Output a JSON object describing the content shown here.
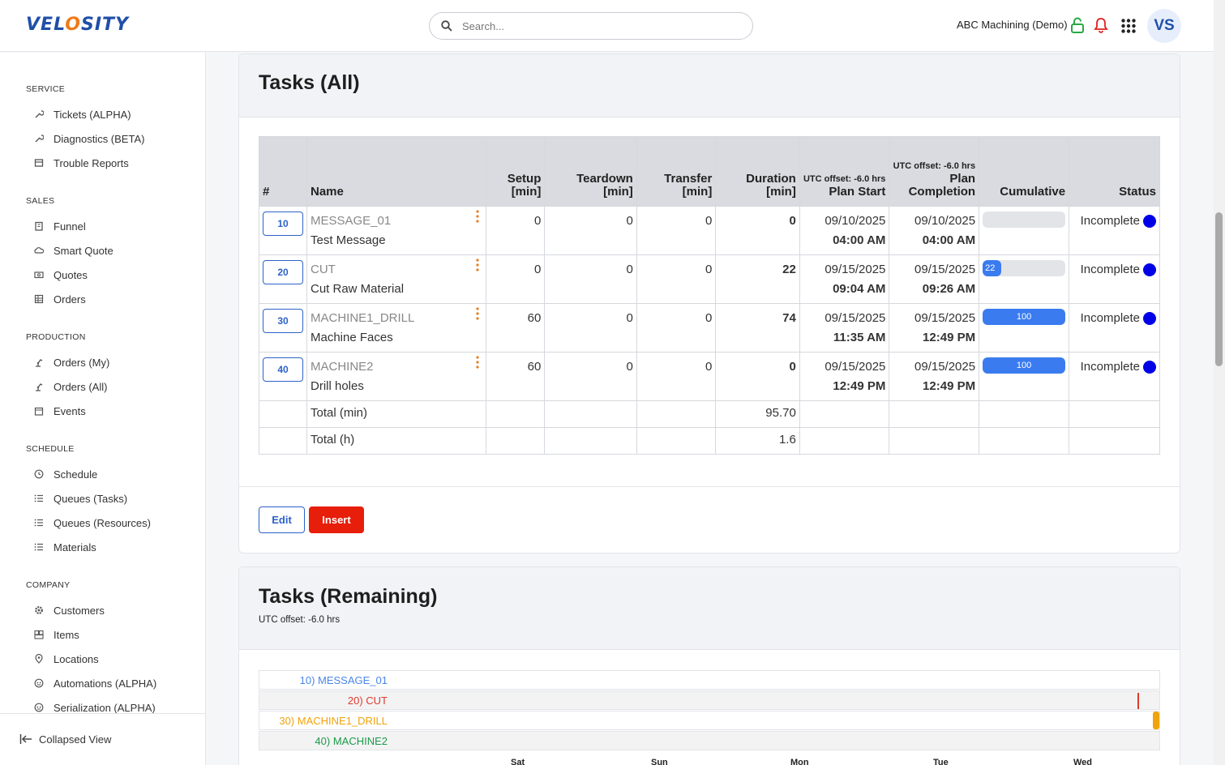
{
  "header": {
    "logo": "VELOSITY",
    "search_placeholder": "Search...",
    "company": "ABC Machining (Demo)",
    "avatar_initials": "VS"
  },
  "sidebar": {
    "sections": [
      {
        "title": "SERVICE",
        "items": [
          "Tickets (ALPHA)",
          "Diagnostics (BETA)",
          "Trouble Reports"
        ]
      },
      {
        "title": "SALES",
        "items": [
          "Funnel",
          "Smart Quote",
          "Quotes",
          "Orders"
        ]
      },
      {
        "title": "PRODUCTION",
        "items": [
          "Orders (My)",
          "Orders (All)",
          "Events"
        ]
      },
      {
        "title": "SCHEDULE",
        "items": [
          "Schedule",
          "Queues (Tasks)",
          "Queues (Resources)",
          "Materials"
        ]
      },
      {
        "title": "COMPANY",
        "items": [
          "Customers",
          "Items",
          "Locations",
          "Automations (ALPHA)",
          "Serialization (ALPHA)"
        ]
      }
    ],
    "collapsed_label": "Collapsed View"
  },
  "tasks_all": {
    "title": "Tasks (All)",
    "headers": {
      "num": "#",
      "name": "Name",
      "setup": [
        "Setup",
        "[min]"
      ],
      "teardown": [
        "Teardown",
        "[min]"
      ],
      "transfer": [
        "Transfer",
        "[min]"
      ],
      "duration": [
        "Duration",
        "[min]"
      ],
      "plan_start_note": "UTC offset: -6.0 hrs",
      "plan_start": "Plan Start",
      "plan_completion_note": "UTC offset: -6.0 hrs",
      "plan_completion": [
        "Plan",
        "Completion"
      ],
      "cumulative": "Cumulative",
      "status": "Status"
    },
    "rows": [
      {
        "op": "10",
        "code": "MESSAGE_01",
        "desc": "Test Message",
        "setup": "0",
        "teardown": "0",
        "transfer": "0",
        "duration": "0",
        "start_date": "09/10/2025",
        "start_time": "04:00 AM",
        "end_date": "09/10/2025",
        "end_time": "04:00 AM",
        "cumulative": 0,
        "cumulative_label": "",
        "status": "Incomplete"
      },
      {
        "op": "20",
        "code": "CUT",
        "desc": "Cut Raw Material",
        "setup": "0",
        "teardown": "0",
        "transfer": "0",
        "duration": "22",
        "start_date": "09/15/2025",
        "start_time": "09:04 AM",
        "end_date": "09/15/2025",
        "end_time": "09:26 AM",
        "cumulative": 22,
        "cumulative_label": "22",
        "status": "Incomplete"
      },
      {
        "op": "30",
        "code": "MACHINE1_DRILL",
        "desc": "Machine Faces",
        "setup": "60",
        "teardown": "0",
        "transfer": "0",
        "duration": "74",
        "start_date": "09/15/2025",
        "start_time": "11:35 AM",
        "end_date": "09/15/2025",
        "end_time": "12:49 PM",
        "cumulative": 100,
        "cumulative_label": "100",
        "status": "Incomplete"
      },
      {
        "op": "40",
        "code": "MACHINE2",
        "desc": "Drill holes",
        "setup": "60",
        "teardown": "0",
        "transfer": "0",
        "duration": "0",
        "start_date": "09/15/2025",
        "start_time": "12:49 PM",
        "end_date": "09/15/2025",
        "end_time": "12:49 PM",
        "cumulative": 100,
        "cumulative_label": "100",
        "status": "Incomplete"
      }
    ],
    "totals": [
      {
        "label": "Total (min)",
        "value": "95.70"
      },
      {
        "label": "Total (h)",
        "value": "1.6"
      }
    ],
    "buttons": {
      "edit": "Edit",
      "insert": "Insert"
    }
  },
  "tasks_remaining": {
    "title": "Tasks (Remaining)",
    "utc_note": "UTC offset: -6.0 hrs",
    "gantt_rows": [
      {
        "label": "10) MESSAGE_01",
        "color": "#4a86e8"
      },
      {
        "label": "20) CUT",
        "color": "#e03a2f"
      },
      {
        "label": "30) MACHINE1_DRILL",
        "color": "#f0a30a"
      },
      {
        "label": "40) MACHINE2",
        "color": "#1a9a4a"
      }
    ],
    "days": [
      "Sat",
      "Sun",
      "Mon",
      "Tue",
      "Wed"
    ]
  }
}
